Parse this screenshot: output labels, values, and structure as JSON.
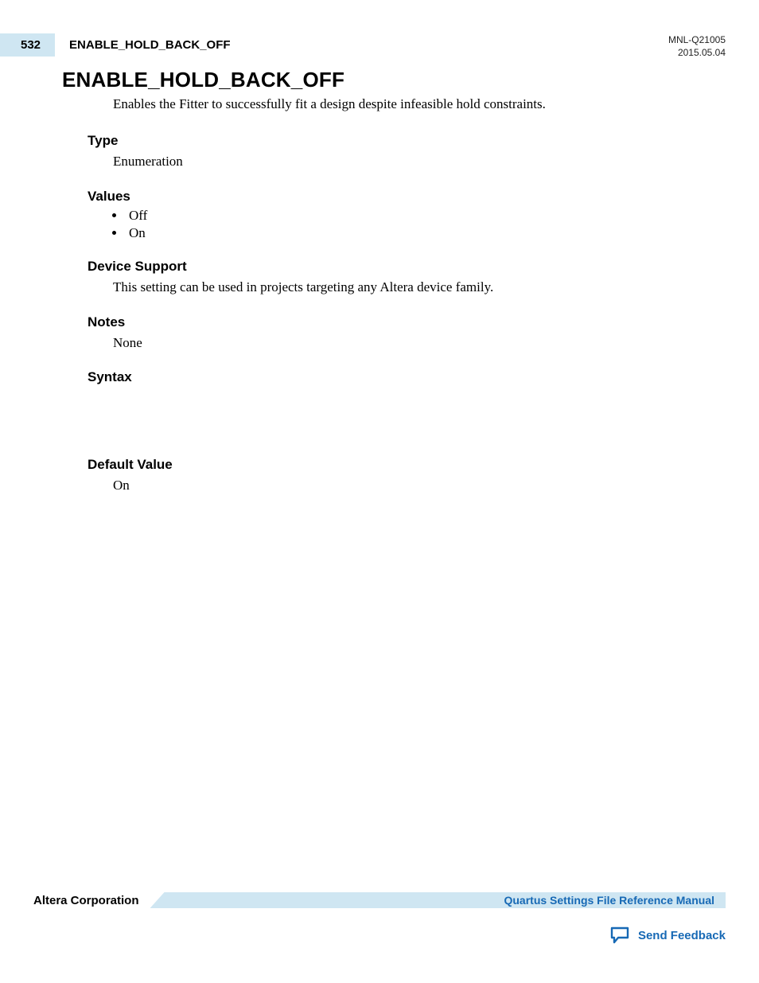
{
  "header": {
    "page_number": "532",
    "running_title": "ENABLE_HOLD_BACK_OFF",
    "doc_id": "MNL-Q21005",
    "doc_date": "2015.05.04"
  },
  "main": {
    "title": "ENABLE_HOLD_BACK_OFF",
    "description": "Enables the Fitter to successfully fit a design despite infeasible hold constraints."
  },
  "sections": {
    "type": {
      "label": "Type",
      "body": "Enumeration"
    },
    "values": {
      "label": "Values",
      "items": [
        "Off",
        "On"
      ]
    },
    "device_support": {
      "label": "Device Support",
      "body": "This setting can be used in projects targeting any Altera device family."
    },
    "notes": {
      "label": "Notes",
      "body": "None"
    },
    "syntax": {
      "label": "Syntax"
    },
    "default_value": {
      "label": "Default Value",
      "body": "On"
    }
  },
  "footer": {
    "company": "Altera Corporation",
    "doc_link": "Quartus Settings File Reference Manual",
    "feedback": "Send Feedback"
  }
}
